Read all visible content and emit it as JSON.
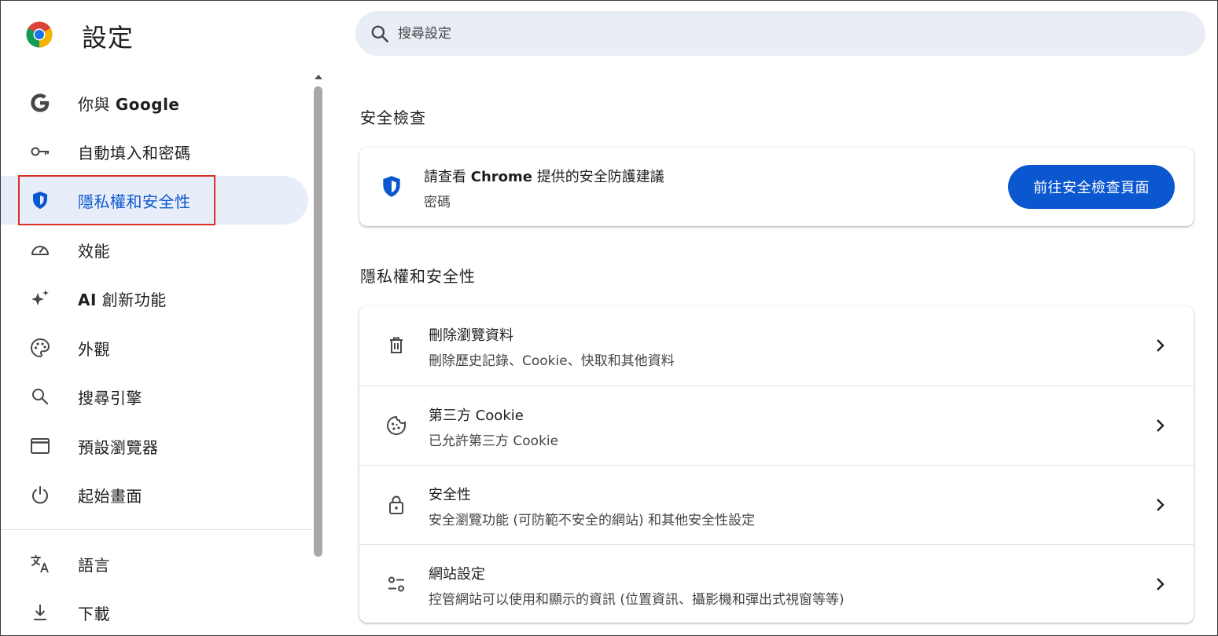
{
  "header": {
    "title": "設定",
    "search_placeholder": "搜尋設定"
  },
  "sidebar": {
    "items": [
      {
        "label_prefix": "你與 ",
        "label_bold": "Google",
        "icon": "google-g-icon"
      },
      {
        "label": "自動填入和密碼",
        "icon": "key-icon"
      },
      {
        "label": "隱私權和安全性",
        "icon": "shield-icon",
        "active": true
      },
      {
        "label": "效能",
        "icon": "speedometer-icon"
      },
      {
        "label_bold": "AI",
        "label_suffix": " 創新功能",
        "icon": "sparkle-icon"
      },
      {
        "label": "外觀",
        "icon": "palette-icon"
      },
      {
        "label": "搜尋引擎",
        "icon": "search-icon"
      },
      {
        "label": "預設瀏覽器",
        "icon": "browser-window-icon"
      },
      {
        "label": "起始畫面",
        "icon": "power-icon"
      },
      {
        "label": "語言",
        "icon": "translate-icon"
      },
      {
        "label": "下載",
        "icon": "download-icon"
      }
    ]
  },
  "safety_check": {
    "section_title": "安全檢查",
    "title_prefix": "請查看 ",
    "title_bold": "Chrome",
    "title_suffix": " 提供的安全防護建議",
    "subtitle": "密碼",
    "button_label": "前往安全檢查頁面"
  },
  "privacy": {
    "section_title": "隱私權和安全性",
    "rows": [
      {
        "title": "刪除瀏覽資料",
        "subtitle": "刪除歷史記錄、Cookie、快取和其他資料",
        "icon": "trash-icon"
      },
      {
        "title": "第三方 Cookie",
        "subtitle": "已允許第三方 Cookie",
        "icon": "cookie-icon"
      },
      {
        "title": "安全性",
        "subtitle": "安全瀏覽功能 (可防範不安全的網站) 和其他安全性設定",
        "icon": "lock-icon"
      },
      {
        "title": "網站設定",
        "subtitle": "控管網站可以使用和顯示的資訊 (位置資訊、攝影機和彈出式視窗等等)",
        "icon": "tune-icon"
      }
    ]
  },
  "colors": {
    "accent": "#0b57d0",
    "active_bg": "#e8eef9",
    "search_bg": "#e9eef6",
    "highlight": "#d93025"
  }
}
